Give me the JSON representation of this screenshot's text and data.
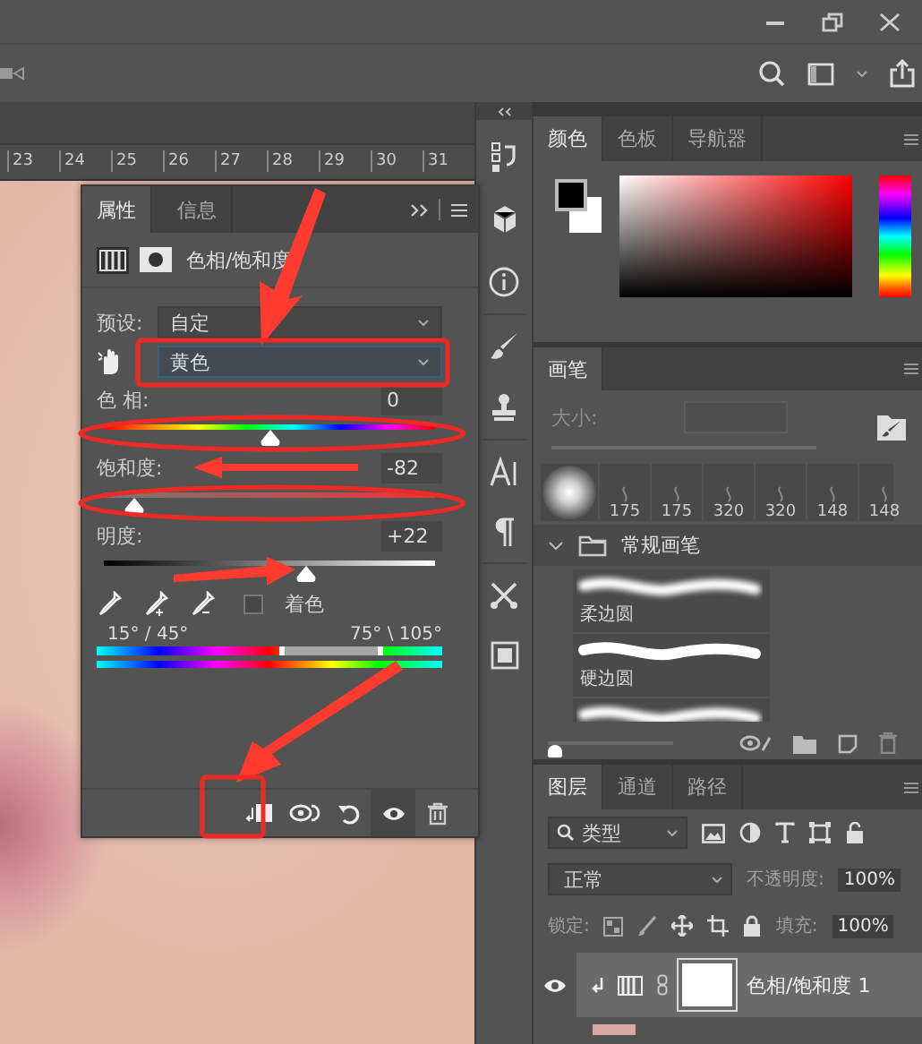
{
  "ruler": {
    "ticks": [
      "23",
      "24",
      "25",
      "26",
      "27",
      "28",
      "29",
      "30",
      "31"
    ]
  },
  "properties_panel": {
    "tabs": [
      {
        "label": "属性",
        "selected": true
      },
      {
        "label": "信息",
        "selected": false
      }
    ],
    "title": "色相/饱和度",
    "preset": {
      "label": "预设:",
      "value": "自定"
    },
    "range": {
      "value": "黄色"
    },
    "sliders": [
      {
        "kind": "hue",
        "label": "色 相:",
        "value": "0",
        "level": 0.5
      },
      {
        "kind": "saturation",
        "label": "饱和度:",
        "value": "-82",
        "level": 0.09
      },
      {
        "kind": "lightness",
        "label": "明度:",
        "value": "+22",
        "level": 0.61
      }
    ],
    "colorize": {
      "label": "着色",
      "checked": false
    },
    "range_left": "15° / 45°",
    "range_right": "75° \\ 105°"
  },
  "color_panel": {
    "tabs": [
      {
        "label": "颜色",
        "selected": true
      },
      {
        "label": "色板",
        "selected": false
      },
      {
        "label": "导航器",
        "selected": false
      }
    ]
  },
  "brush_panel": {
    "tabs": [
      {
        "label": "画笔",
        "selected": true
      }
    ],
    "size_label": "大小:",
    "presets": [
      "175",
      "175",
      "320",
      "320",
      "148",
      "148"
    ],
    "group": {
      "name": "常规画笔",
      "expanded": true
    },
    "brushes": [
      {
        "kind": "soft",
        "name": "柔边圆"
      },
      {
        "kind": "hard",
        "name": "硬边圆"
      },
      {
        "kind": "soft"
      }
    ],
    "preview_size": {
      "level": 0.05
    }
  },
  "layers_panel": {
    "tabs": [
      {
        "label": "图层",
        "selected": true
      },
      {
        "label": "通道",
        "selected": false
      },
      {
        "label": "路径",
        "selected": false
      }
    ],
    "filter": "类型",
    "blend_mode": "正常",
    "opacity": {
      "label": "不透明度:",
      "value": "100%"
    },
    "lock_label": "锁定:",
    "fill": {
      "label": "填充:",
      "value": "100%"
    },
    "layers": [
      {
        "name": "色相/饱和度 1",
        "visible": true,
        "selected": true
      }
    ]
  }
}
